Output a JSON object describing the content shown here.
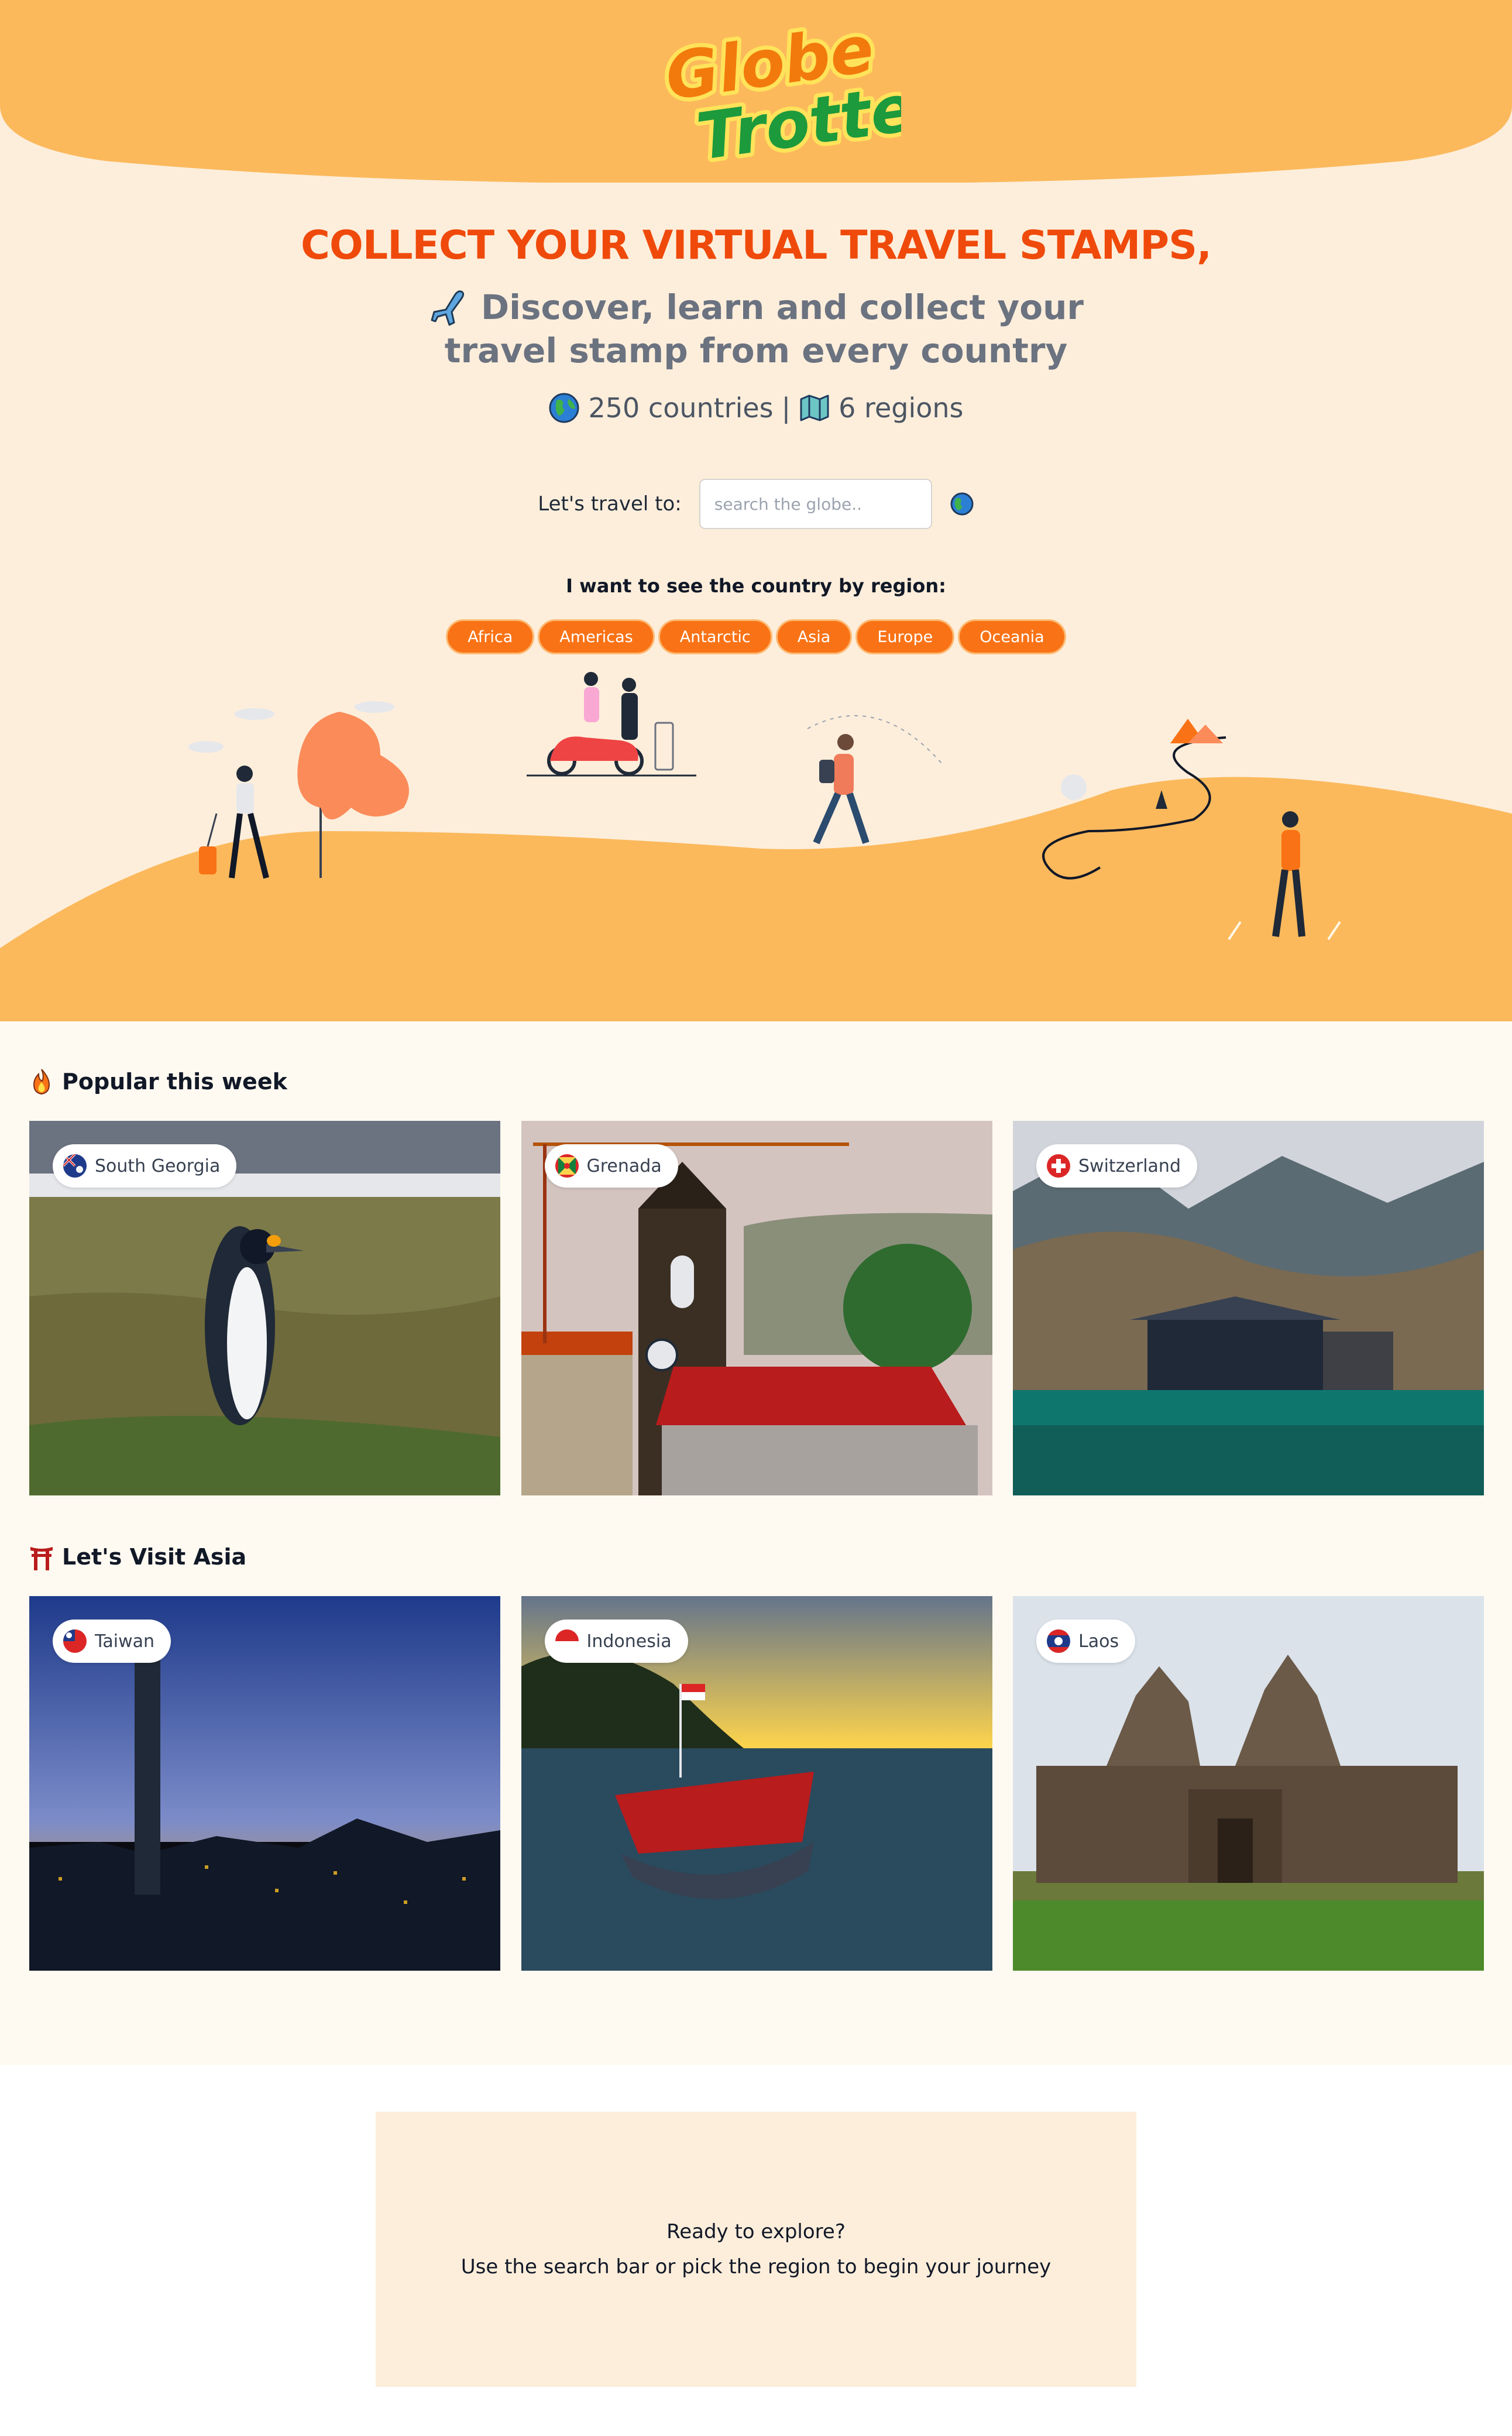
{
  "brand": {
    "logo_text_1": "Globe",
    "logo_text_2": "Trotter",
    "primary": "#ef4a0b",
    "accent": "#f97316",
    "sand": "#fbb95c",
    "cream": "#fdeedb"
  },
  "hero": {
    "headline": "COLLECT YOUR VIRTUAL TRAVEL STAMPS,",
    "sub_line_1": "Discover, learn and collect your",
    "sub_line_2": "travel stamp from every country",
    "sub_icon": "airplane-icon",
    "countries": "250 countries",
    "separator": "|",
    "regions_count": "6 regions"
  },
  "search": {
    "label": "Let's travel to:",
    "placeholder": "search the globe..",
    "value": ""
  },
  "regions": {
    "title": "I want to see the country by region:",
    "items": [
      "Africa",
      "Americas",
      "Antarctic",
      "Asia",
      "Europe",
      "Oceania"
    ]
  },
  "popular": {
    "title": "Popular this week",
    "icon": "fire-icon",
    "cards": [
      {
        "country": "South Georgia",
        "flag": "south-georgia-flag",
        "photo": "king penguin on grassland"
      },
      {
        "country": "Grenada",
        "flag": "grenada-flag",
        "photo": "clock tower church"
      },
      {
        "country": "Switzerland",
        "flag": "switzerland-flag",
        "photo": "alpine lake cabin"
      }
    ]
  },
  "asia": {
    "title": "Let's Visit Asia",
    "icon": "torii-gate-icon",
    "cards": [
      {
        "country": "Taiwan",
        "flag": "taiwan-flag",
        "photo": "city skyline at dusk"
      },
      {
        "country": "Indonesia",
        "flag": "indonesia-flag",
        "photo": "boat on sunset harbor"
      },
      {
        "country": "Laos",
        "flag": "laos-flag",
        "photo": "ancient temple ruins"
      }
    ]
  },
  "cta": {
    "line_1": "Ready to explore?",
    "line_2": "Use the search bar or pick the region to begin your journey"
  }
}
